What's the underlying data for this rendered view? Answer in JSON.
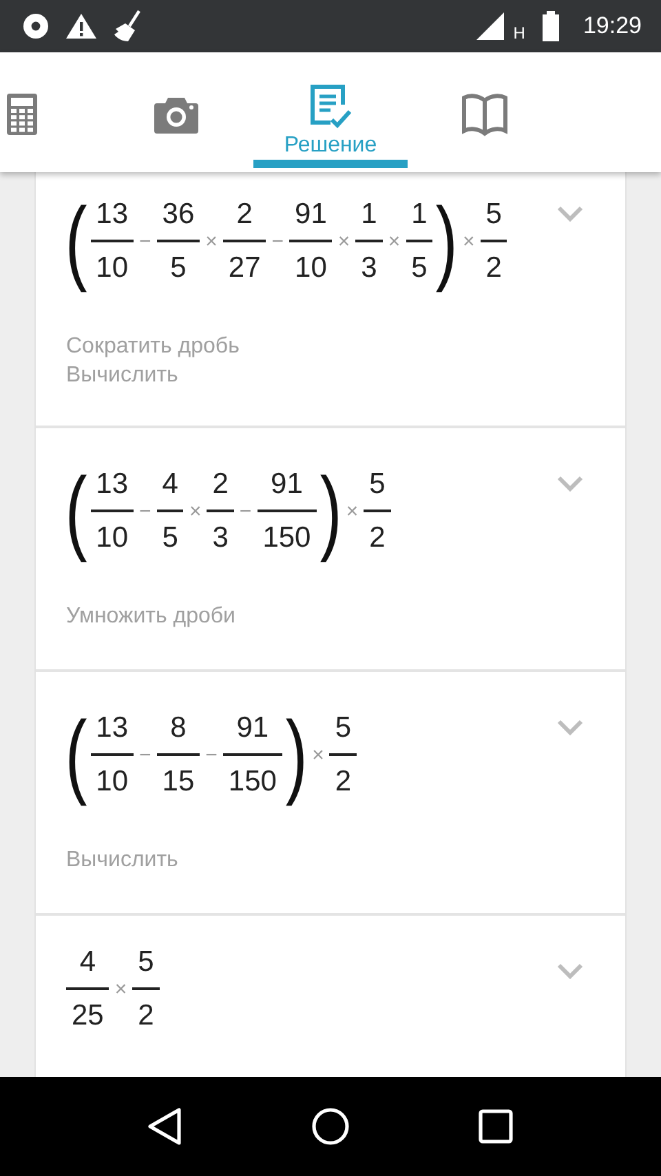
{
  "status_bar": {
    "network": "H",
    "time": "19:29"
  },
  "tabs": [
    {
      "kind": "calculator",
      "selected": false
    },
    {
      "kind": "camera",
      "selected": false
    },
    {
      "kind": "solution",
      "label": "Решение",
      "selected": true
    },
    {
      "kind": "book",
      "selected": false
    }
  ],
  "steps": [
    {
      "expression": [
        {
          "kind": "paren",
          "text": "("
        },
        {
          "kind": "frac",
          "num": "13",
          "den": "10"
        },
        {
          "kind": "op",
          "text": "−"
        },
        {
          "kind": "frac",
          "num": "36",
          "den": "5"
        },
        {
          "kind": "op",
          "text": "×"
        },
        {
          "kind": "frac",
          "num": "2",
          "den": "27"
        },
        {
          "kind": "op",
          "text": "−"
        },
        {
          "kind": "frac",
          "num": "91",
          "den": "10"
        },
        {
          "kind": "op",
          "text": "×"
        },
        {
          "kind": "frac",
          "num": "1",
          "den": "3"
        },
        {
          "kind": "op",
          "text": "×"
        },
        {
          "kind": "frac",
          "num": "1",
          "den": "5"
        },
        {
          "kind": "paren",
          "text": ")"
        },
        {
          "kind": "op",
          "text": "×"
        },
        {
          "kind": "frac",
          "num": "5",
          "den": "2"
        }
      ],
      "hints": [
        "Сократить дробь",
        "Вычислить"
      ],
      "expanded": false
    },
    {
      "expression": [
        {
          "kind": "paren",
          "text": "("
        },
        {
          "kind": "frac",
          "num": "13",
          "den": "10"
        },
        {
          "kind": "op",
          "text": "−"
        },
        {
          "kind": "frac",
          "num": "4",
          "den": "5"
        },
        {
          "kind": "op",
          "text": "×"
        },
        {
          "kind": "frac",
          "num": "2",
          "den": "3"
        },
        {
          "kind": "op",
          "text": "−"
        },
        {
          "kind": "frac",
          "num": "91",
          "den": "150"
        },
        {
          "kind": "paren",
          "text": ")"
        },
        {
          "kind": "op",
          "text": "×"
        },
        {
          "kind": "frac",
          "num": "5",
          "den": "2"
        }
      ],
      "hints": [
        "Умножить дроби"
      ],
      "expanded": false
    },
    {
      "expression": [
        {
          "kind": "paren",
          "text": "("
        },
        {
          "kind": "frac",
          "num": "13",
          "den": "10"
        },
        {
          "kind": "op",
          "text": "−"
        },
        {
          "kind": "frac",
          "num": "8",
          "den": "15"
        },
        {
          "kind": "op",
          "text": "−"
        },
        {
          "kind": "frac",
          "num": "91",
          "den": "150"
        },
        {
          "kind": "paren",
          "text": ")"
        },
        {
          "kind": "op",
          "text": "×"
        },
        {
          "kind": "frac",
          "num": "5",
          "den": "2"
        }
      ],
      "hints": [
        "Вычислить"
      ],
      "expanded": false
    },
    {
      "expression": [
        {
          "kind": "frac",
          "num": "4",
          "den": "25"
        },
        {
          "kind": "op",
          "text": "×"
        },
        {
          "kind": "frac",
          "num": "5",
          "den": "2"
        }
      ],
      "expanded": false
    }
  ]
}
